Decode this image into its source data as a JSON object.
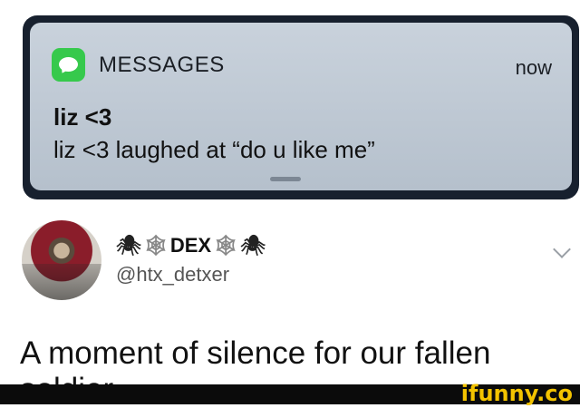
{
  "notification": {
    "app_name": "MESSAGES",
    "time": "now",
    "sender": "liz <3",
    "body": "liz <3 laughed at “do u like me”",
    "app_icon": "messages-icon",
    "accent": "#36c94c"
  },
  "tweet": {
    "display_name_prefix": "🕷",
    "web_left": "🕸",
    "display_name": "DEX",
    "web_right": "🕸",
    "display_name_suffix": "🕷",
    "username": "@htx_detxer",
    "text": "A moment of silence for our fallen soldier",
    "menu_icon": "chevron-down-icon"
  },
  "watermark": {
    "text": "ifunny.co",
    "color": "#f3c300"
  }
}
